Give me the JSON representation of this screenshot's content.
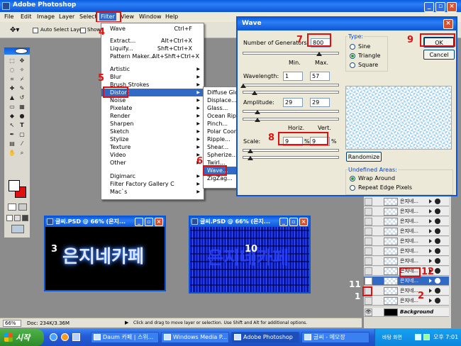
{
  "app": {
    "title": "Adobe Photoshop"
  },
  "menubar": [
    "File",
    "Edit",
    "Image",
    "Layer",
    "Select",
    "Filter",
    "View",
    "Window",
    "Help"
  ],
  "options_bar": {
    "auto_select_label": "Auto Select Layer",
    "show_label": "Show"
  },
  "filter_menu": [
    {
      "label": "Wave",
      "shortcut": "Ctrl+F"
    },
    {
      "label": "Extract...",
      "shortcut": "Alt+Ctrl+X"
    },
    {
      "label": "Liquify...",
      "shortcut": "Shft+Ctrl+X"
    },
    {
      "label": "Pattern Maker...",
      "shortcut": "Alt+Shft+Ctrl+X"
    },
    {
      "label": "Artistic"
    },
    {
      "label": "Blur"
    },
    {
      "label": "Brush Strokes"
    },
    {
      "label": "Distort"
    },
    {
      "label": "Noise"
    },
    {
      "label": "Pixelate"
    },
    {
      "label": "Render"
    },
    {
      "label": "Sharpen"
    },
    {
      "label": "Sketch"
    },
    {
      "label": "Stylize"
    },
    {
      "label": "Texture"
    },
    {
      "label": "Video"
    },
    {
      "label": "Other"
    },
    {
      "label": "Digimarc"
    },
    {
      "label": "Filter Factory Gallery C"
    },
    {
      "label": "Mac`s"
    }
  ],
  "distort_submenu": [
    "Diffuse Glow",
    "Displace...",
    "Glass...",
    "Ocean Ripple",
    "Pinch...",
    "Polar Coord",
    "Ripple...",
    "Shear...",
    "Spherize...",
    "Twirl...",
    "Wave...",
    "ZigZag..."
  ],
  "wave_dialog": {
    "title": "Wave",
    "generators_label": "Number of Generators:",
    "generators_value": "800",
    "min_label": "Min.",
    "max_label": "Max.",
    "wavelength_label": "Wavelength:",
    "wavelength_min": "1",
    "wavelength_max": "57",
    "amplitude_label": "Amplitude:",
    "amplitude_min": "29",
    "amplitude_max": "29",
    "horiz_label": "Horiz.",
    "vert_label": "Vert.",
    "scale_label": "Scale:",
    "scale_horiz": "9",
    "scale_vert": "9",
    "percent": "%",
    "type_label": "Type:",
    "types": [
      "Sine",
      "Triangle",
      "Square"
    ],
    "randomize_label": "Randomize",
    "undefined_label": "Undefined Areas:",
    "undefined_options": [
      "Wrap Around",
      "Repeat Edge Pixels"
    ],
    "ok_label": "OK",
    "cancel_label": "Cancel"
  },
  "doc1": {
    "title": "글씨.PSD @ 66% (은지...",
    "text": "은지네카페"
  },
  "doc2": {
    "title": "글씨.PSD @ 66% (은지...",
    "text": "은지네카페"
  },
  "layers": [
    "은지네...",
    "은지네...",
    "은지네...",
    "은지네...",
    "은지네...",
    "은지네...",
    "은지네...",
    "은지네...",
    "은지네...",
    "은지네...",
    "은지네...",
    "Background"
  ],
  "status_bar": {
    "zoom": "66%",
    "doc": "Doc: 234K/3.36M",
    "hint": "Click and drag to move layer or selection. Use Shift and Alt for additional options."
  },
  "taskbar": {
    "start": "시작",
    "items": [
      "Daum 카페 | 스위...",
      "Windows Media P...",
      "Adobe Photoshop",
      "글씨 - 메모장"
    ],
    "ime": "바탕 화면",
    "clock": "오후 7:01"
  },
  "annotations": {
    "n1": "1",
    "n2": "2",
    "n3": "3",
    "n4": "4",
    "n5": "5",
    "n6": "6",
    "n7": "7",
    "n8": "8",
    "n9": "9",
    "n10": "10",
    "n11": "11",
    "n12": "12"
  },
  "colors": {
    "title_blue": "#0a5ee0",
    "highlight": "#316ac5",
    "annotation": "#e01010",
    "doc_bg": "#000000",
    "glow_text": "#7aa8ff"
  }
}
